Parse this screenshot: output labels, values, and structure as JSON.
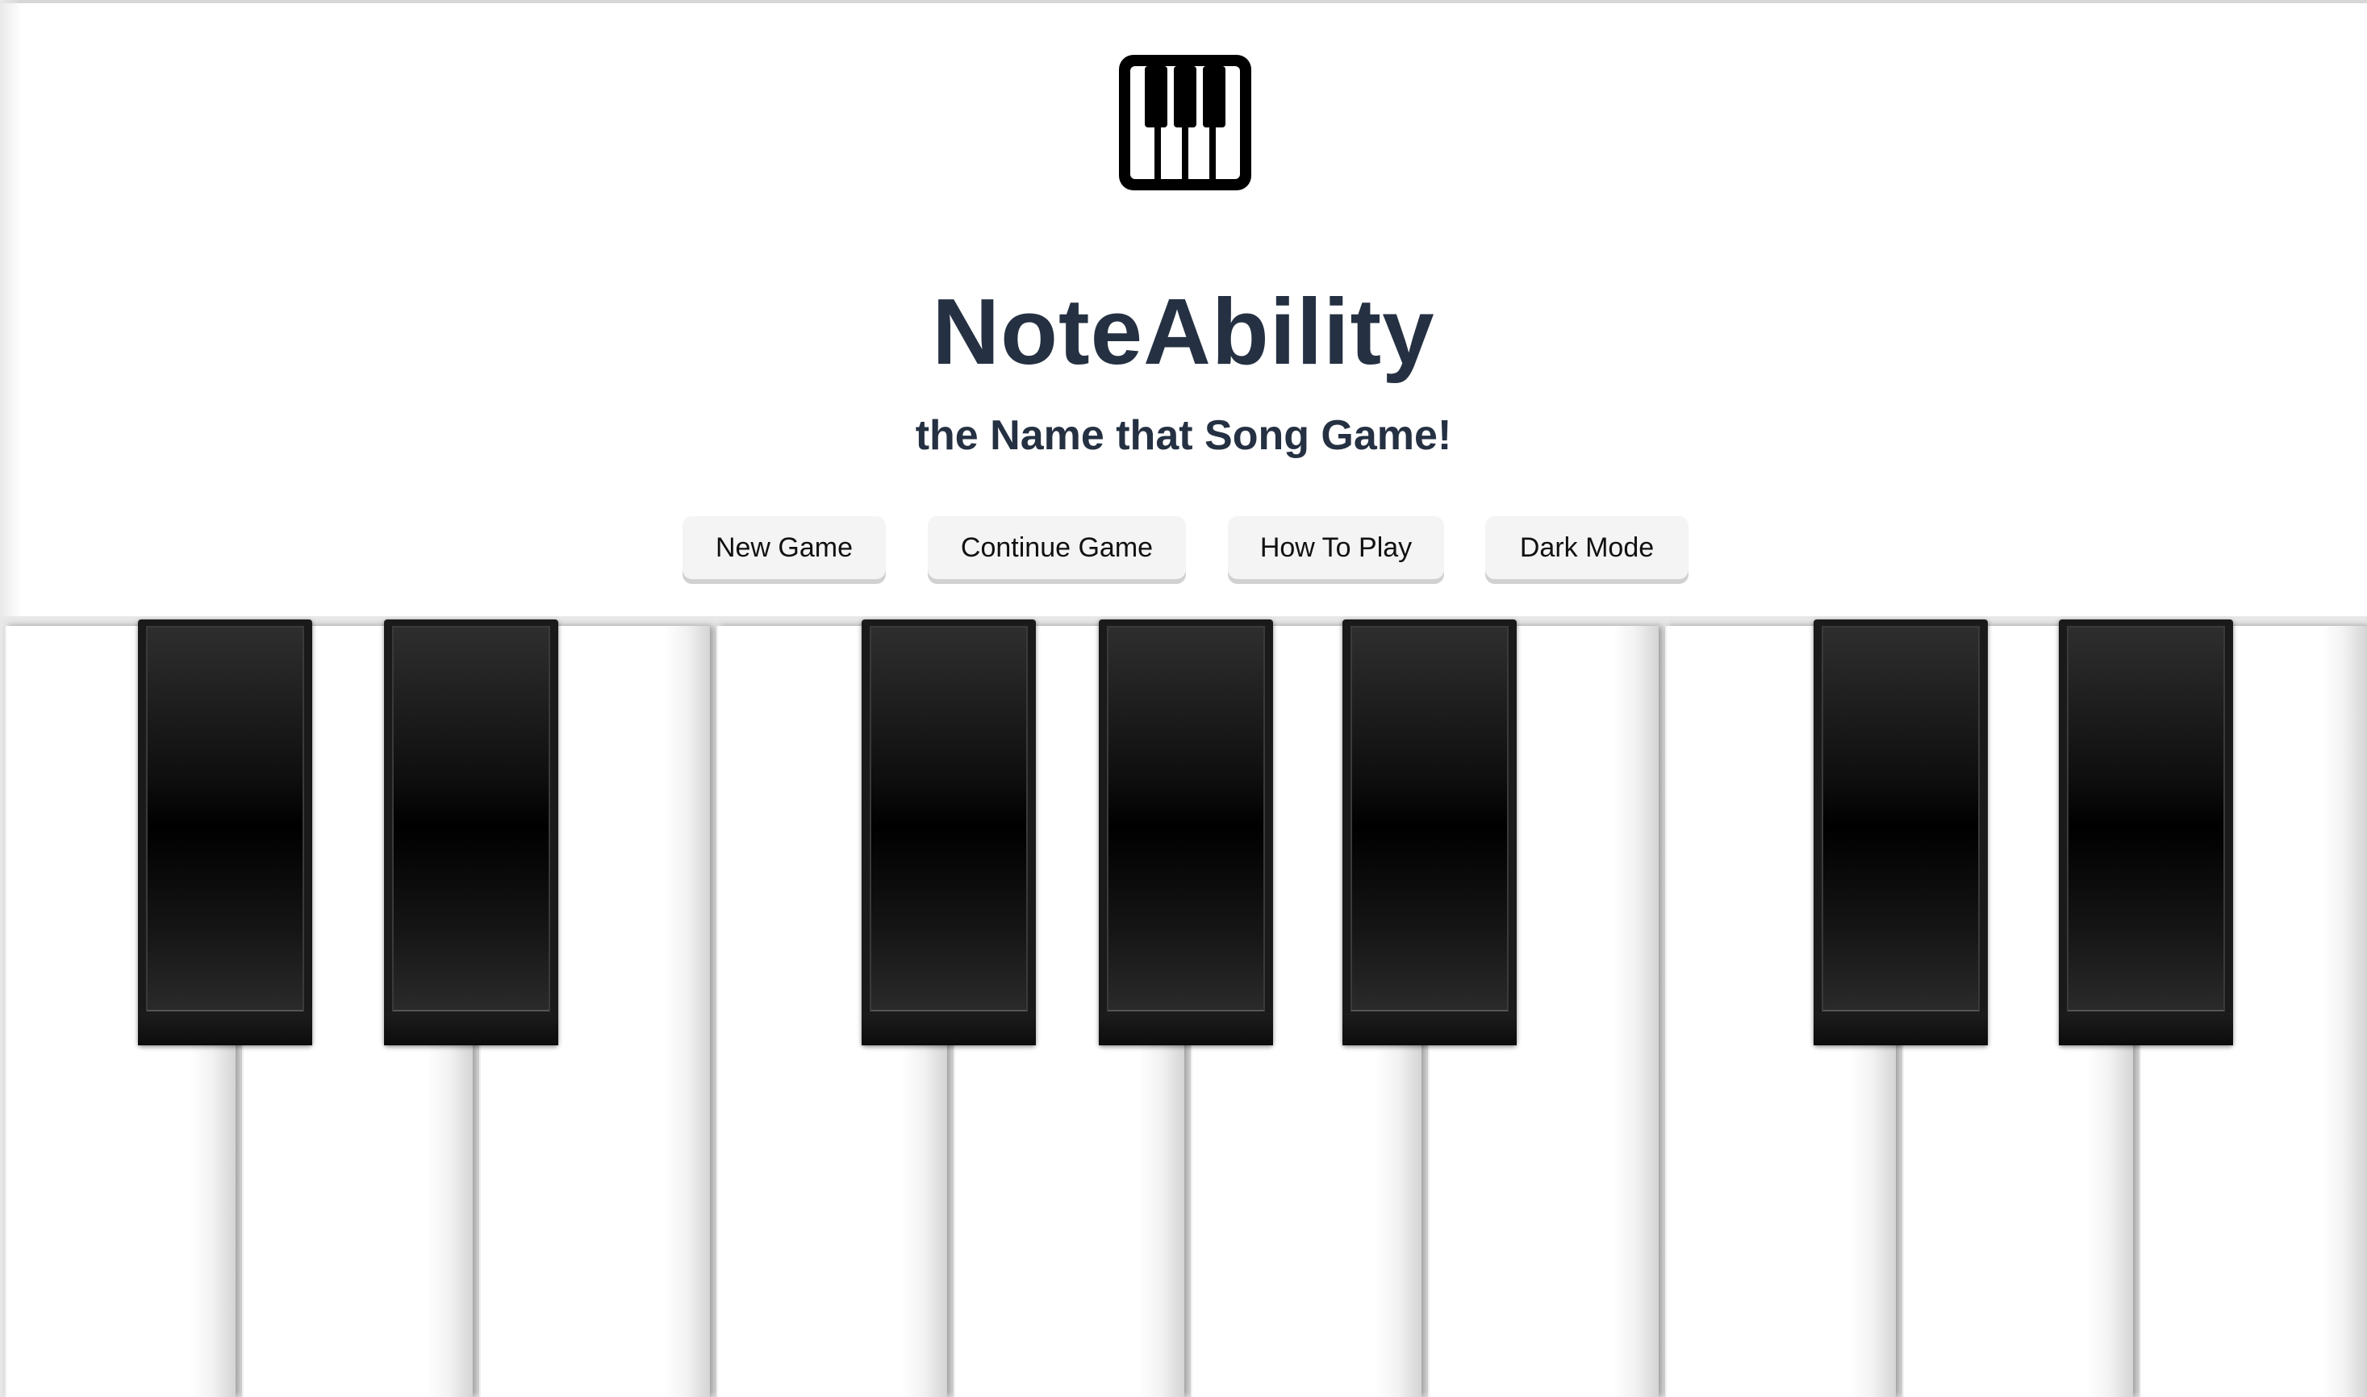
{
  "app": {
    "logo_icon": "piano-keys-icon",
    "title": "NoteAbility",
    "subtitle": "the Name that Song Game!"
  },
  "menu": {
    "new_game": "New Game",
    "continue_game": "Continue Game",
    "how_to_play": "How To Play",
    "dark_mode": "Dark Mode"
  },
  "keyboard": {
    "white_key_count": 10,
    "black_key_count": 7
  },
  "colors": {
    "title": "#253142",
    "button_bg": "#f4f4f4",
    "button_shadow": "#d1d1d1",
    "black_key": "#000000",
    "white_key": "#ffffff"
  }
}
